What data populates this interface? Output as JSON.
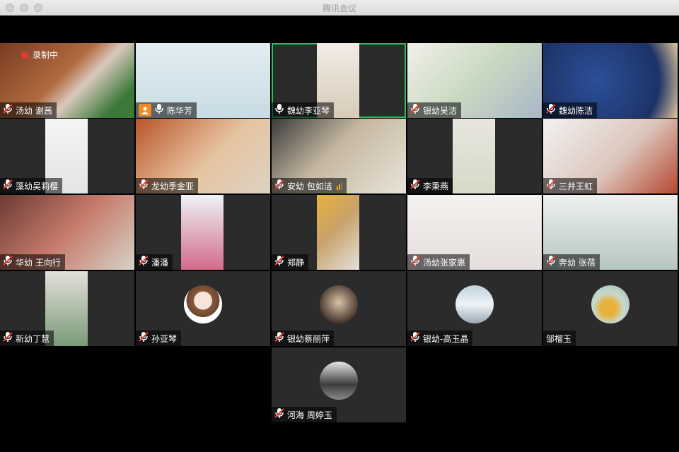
{
  "window": {
    "title": "腾讯会议"
  },
  "recording": {
    "label": "录制中"
  },
  "colors": {
    "active_speaker": "#29c15b",
    "muted_mic": "#e23b2e",
    "host": "#f08a24"
  },
  "participants": [
    {
      "name": "汤幼 谢茜",
      "mic": "muted"
    },
    {
      "name": "陈华芳",
      "mic": "on",
      "host": true
    },
    {
      "name": "魏幼李亚琴",
      "mic": "on",
      "active": true
    },
    {
      "name": "银幼吴洁",
      "mic": "muted"
    },
    {
      "name": "魏幼陈洁",
      "mic": "muted"
    },
    {
      "name": "藻幼吴莉樱",
      "mic": "muted"
    },
    {
      "name": "龙幼季金亚",
      "mic": "muted"
    },
    {
      "name": "安幼 包如洁",
      "mic": "muted",
      "signal": "weak"
    },
    {
      "name": "李秉燕",
      "mic": "muted"
    },
    {
      "name": "三井王虹",
      "mic": "muted"
    },
    {
      "name": "华幼 王向行",
      "mic": "muted"
    },
    {
      "name": "潘潘",
      "mic": "muted"
    },
    {
      "name": "郑静",
      "mic": "muted"
    },
    {
      "name": "汤幼张家惠",
      "mic": "muted"
    },
    {
      "name": "奔幼 张蓓",
      "mic": "muted"
    },
    {
      "name": "新幼丁慧",
      "mic": "muted"
    },
    {
      "name": "孙亚琴",
      "mic": "muted",
      "avatar": "cartoon-girl-avatar"
    },
    {
      "name": "银幼蔡丽萍",
      "mic": "muted",
      "avatar": "photo-avatar"
    },
    {
      "name": "银幼-高玉晶",
      "mic": "muted",
      "avatar": "sky-photo-avatar"
    },
    {
      "name": "邹榴玉",
      "mic": "none",
      "avatar": "flower-photo-avatar"
    },
    {
      "name": "河海 周婷玉",
      "mic": "muted",
      "avatar": "group-photo-avatar"
    }
  ]
}
